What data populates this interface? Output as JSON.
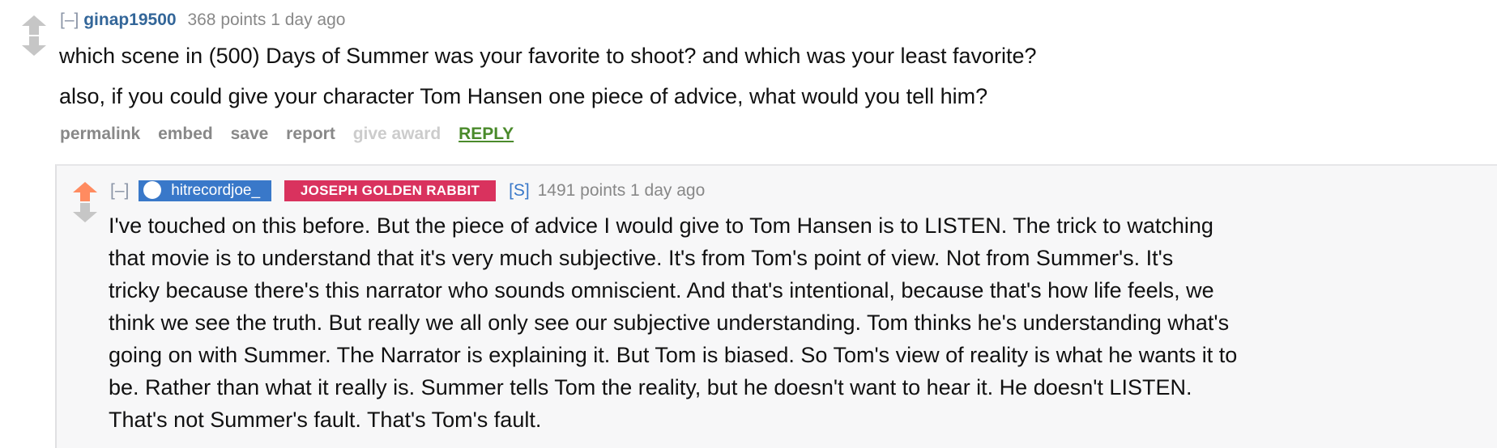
{
  "parent": {
    "expand": "[–]",
    "author": "ginap19500",
    "meta": "368 points 1 day ago",
    "paragraphs": [
      "which scene in (500) Days of Summer was your favorite to shoot? and which was your least favorite?",
      "also, if you could give your character Tom Hansen one piece of advice, what would you tell him?"
    ],
    "buttons": {
      "permalink": "permalink",
      "embed": "embed",
      "save": "save",
      "report": "report",
      "give_award": "give award",
      "reply": "REPLY"
    },
    "vote_state": "none"
  },
  "child": {
    "expand": "[–]",
    "author": "hitrecordjoe_",
    "flair": "JOSEPH GOLDEN RABBIT",
    "submitter_tag": "[S]",
    "meta": "1491 points 1 day ago",
    "vote_state": "upvoted",
    "text": "I've touched on this before. But the piece of advice I would give to Tom Hansen is to LISTEN. The trick to watching\nthat movie is to understand that it's very much subjective. It's from Tom's point of view. Not from Summer's. It's\ntricky because there's this narrator who sounds omniscient. And that's intentional, because that's how life feels, we\nthink we see the truth. But really we all only see our subjective understanding. Tom thinks he's understanding what's\ngoing on with Summer. The Narrator is explaining it. But Tom is biased. So Tom's view of reality is what he wants it to\nbe. Rather than what it really is. Summer tells Tom the reality, but he doesn't want to hear it. He doesn't LISTEN.\nThat's not Summer's fault. That's Tom's fault."
  },
  "colors": {
    "upvoted_arrow": "#ff8b60",
    "neutral_arrow": "#c6c6c6",
    "author": "#336699",
    "flair_user_bg": "#3978c9",
    "flair_tag_bg": "#d9325e",
    "reply_link": "#4a8a2b"
  }
}
